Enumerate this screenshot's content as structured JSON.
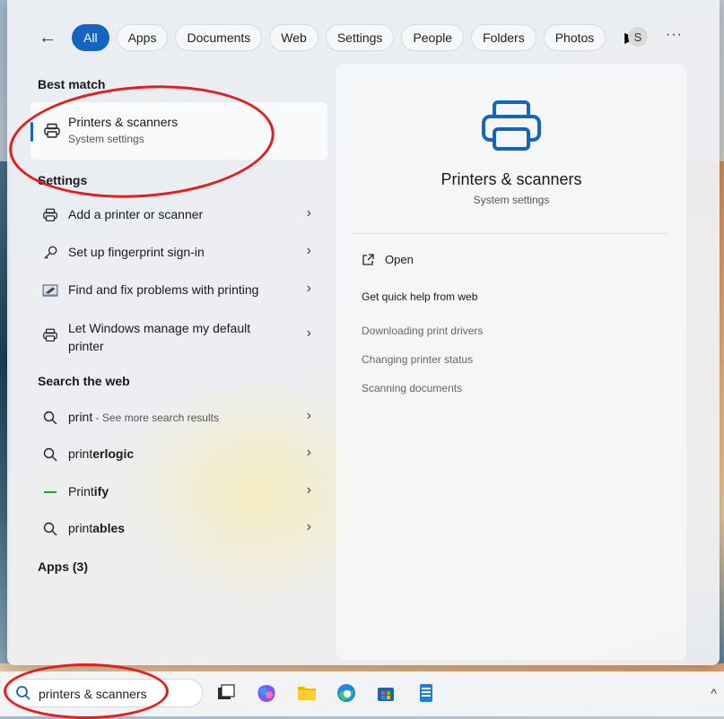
{
  "filters": {
    "back_label": "←",
    "chips": [
      "All",
      "Apps",
      "Documents",
      "Web",
      "Settings",
      "People",
      "Folders",
      "Photos"
    ],
    "play_label": "▶",
    "avatar_letter": "S",
    "more_label": "···"
  },
  "best_match": {
    "heading": "Best match",
    "title": "Printers & scanners",
    "subtitle": "System settings"
  },
  "settings": {
    "heading": "Settings",
    "items": [
      {
        "label": "Add a printer or scanner",
        "icon": "printer-icon"
      },
      {
        "label": "Set up fingerprint sign-in",
        "icon": "key-icon"
      },
      {
        "label": "Find and fix problems with printing",
        "icon": "troubleshoot-icon"
      },
      {
        "label": "Let Windows manage my default printer",
        "icon": "printer-icon"
      }
    ]
  },
  "web": {
    "heading": "Search the web",
    "items": [
      {
        "pre": "print",
        "bold": "",
        "extra": " - See more search results",
        "icon": "search-icon"
      },
      {
        "pre": "print",
        "bold": "erlogic",
        "extra": "",
        "icon": "search-icon"
      },
      {
        "pre": "Print",
        "bold": "ify",
        "extra": "",
        "icon": "printify-logo"
      },
      {
        "pre": "print",
        "bold": "ables",
        "extra": "",
        "icon": "search-icon"
      }
    ]
  },
  "apps": {
    "heading": "Apps (3)"
  },
  "preview": {
    "title": "Printers & scanners",
    "subtitle": "System settings",
    "open_label": "Open",
    "help_heading": "Get quick help from web",
    "links": [
      "Downloading print drivers",
      "Changing printer status",
      "Scanning documents"
    ]
  },
  "taskbar": {
    "search_value": "printers & scanners",
    "tray_label": "^"
  },
  "chevron": "›",
  "colors": {
    "accent": "#1565c0",
    "annotation": "#e41d1d"
  }
}
